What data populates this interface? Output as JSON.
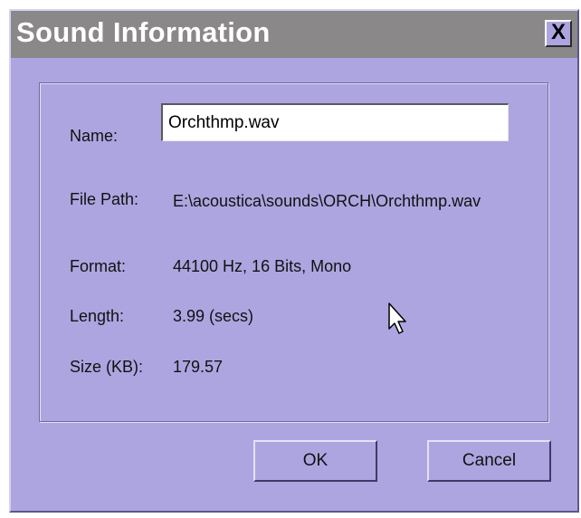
{
  "window": {
    "title": "Sound Information",
    "close_label": "X"
  },
  "fields": {
    "name_label": "Name:",
    "name_value": "Orchthmp.wav",
    "path_label": "File Path:",
    "path_value": "E:\\acoustica\\sounds\\ORCH\\Orchthmp.wav",
    "format_label": "Format:",
    "format_value": "44100 Hz, 16 Bits, Mono",
    "length_label": "Length:",
    "length_value": "3.99 (secs)",
    "size_label": "Size (KB):",
    "size_value": "179.57"
  },
  "buttons": {
    "ok_label": "OK",
    "cancel_label": "Cancel"
  },
  "icons": {
    "close": "close-icon",
    "cursor": "mouse-pointer-icon"
  },
  "colors": {
    "dialog_bg": "#ada5e0",
    "titlebar_bg": "#8a8888",
    "title_text": "#ffffff"
  }
}
